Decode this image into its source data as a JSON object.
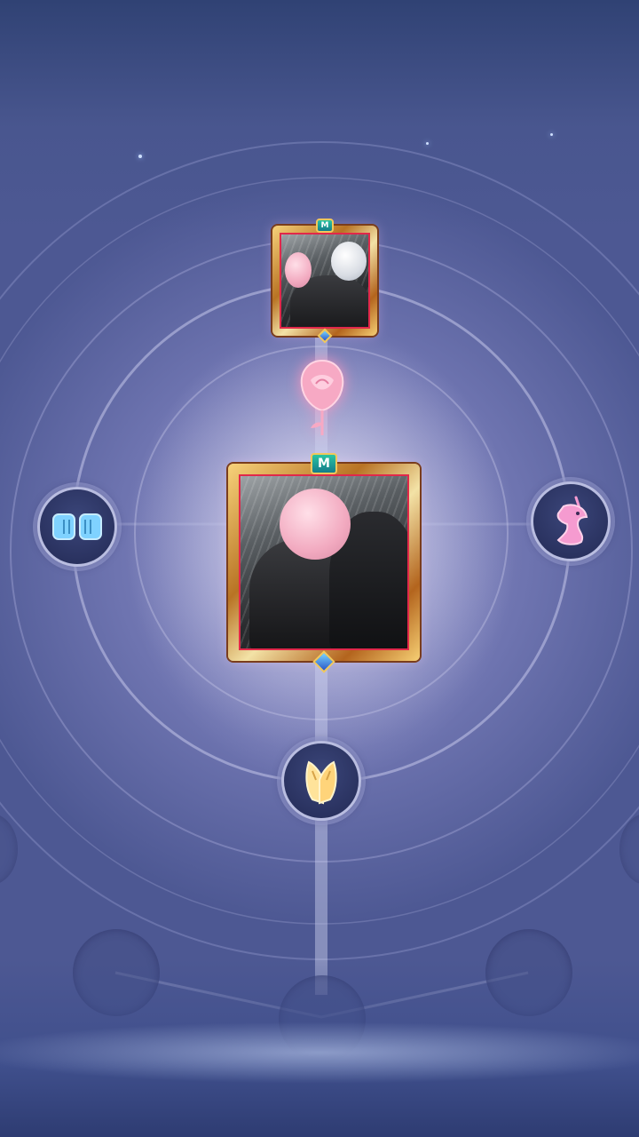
{
  "screen": {
    "name": "relationship-bond-tree",
    "colors": {
      "background": "#6e74b0",
      "frame_gold": "#d9a24a",
      "frame_red": "#e1284a",
      "emblem_teal": "#2bc5a2",
      "rose_pink": "#f7a9c4",
      "fist_blue": "#7fd2ff",
      "unicorn_pink": "#f59bd0",
      "hands_gold": "#ffe39a"
    }
  },
  "portraits": {
    "top": {
      "icon": "portrait-white-hair-icon",
      "emblem_icon": "emblem-icon"
    },
    "center": {
      "icon": "portrait-pink-hair-icon",
      "emblem_icon": "emblem-icon"
    }
  },
  "connector": {
    "icon": "rose-icon"
  },
  "nodes": [
    {
      "icon": "fist-bump-icon",
      "state": "unlocked"
    },
    {
      "icon": "unicorn-icon",
      "state": "unlocked"
    },
    {
      "icon": "clasped-hands-icon",
      "state": "unlocked"
    },
    {
      "icon": "empty-slot",
      "state": "locked"
    },
    {
      "icon": "empty-slot",
      "state": "locked"
    },
    {
      "icon": "empty-slot",
      "state": "locked"
    }
  ]
}
